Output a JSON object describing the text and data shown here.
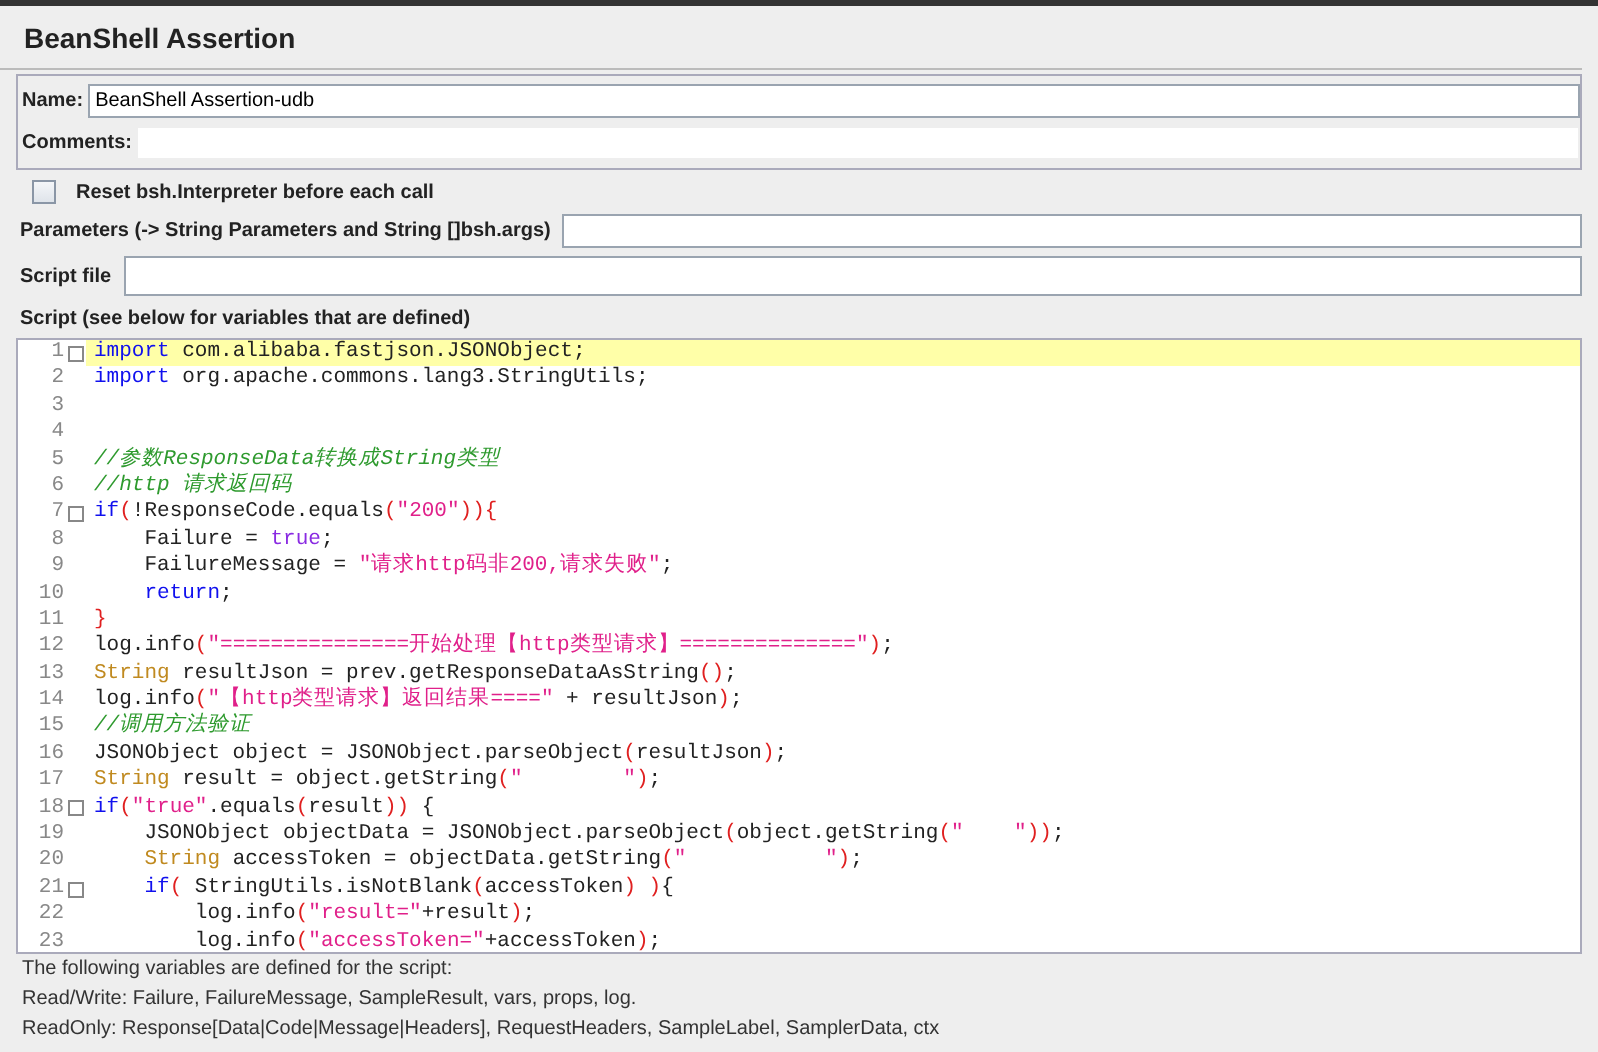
{
  "panel": {
    "title": "BeanShell Assertion"
  },
  "name_field": {
    "label": "Name:",
    "value": "BeanShell Assertion-udb"
  },
  "comments_field": {
    "label": "Comments:"
  },
  "reset_checkbox": {
    "label": "Reset bsh.Interpreter before each call",
    "checked": false
  },
  "parameters_field": {
    "label": "Parameters (-> String Parameters and String []bsh.args)"
  },
  "script_file_field": {
    "label": "Script file"
  },
  "script": {
    "label": "Script (see below for variables that are defined)",
    "lines": [
      {
        "number": "1",
        "fold": true,
        "current": true,
        "tokens": [
          {
            "kind": "keyword",
            "text": "import"
          },
          {
            "kind": "plain",
            "text": " com.alibaba.fastjson.JSONObject;"
          }
        ]
      },
      {
        "number": "2",
        "fold": false,
        "current": false,
        "tokens": [
          {
            "kind": "keyword",
            "text": "import"
          },
          {
            "kind": "plain",
            "text": " org.apache.commons.lang3.StringUtils;"
          }
        ]
      },
      {
        "number": "3",
        "fold": false,
        "current": false
      },
      {
        "number": "4",
        "fold": false,
        "current": false
      },
      {
        "number": "5",
        "fold": false,
        "current": false,
        "tokens": [
          {
            "kind": "comment",
            "text": "//参数ResponseData转换成String类型"
          }
        ]
      },
      {
        "number": "6",
        "fold": false,
        "current": false,
        "tokens": [
          {
            "kind": "comment",
            "text": "//http 请求返回码"
          }
        ]
      },
      {
        "number": "7",
        "fold": true,
        "current": false,
        "tokens": [
          {
            "kind": "keyword",
            "text": "if"
          },
          {
            "kind": "paren",
            "text": "("
          },
          {
            "kind": "plain",
            "text": "!ResponseCode.equals"
          },
          {
            "kind": "paren",
            "text": "("
          },
          {
            "kind": "string",
            "text": "\"200\""
          },
          {
            "kind": "paren",
            "text": ")){"
          }
        ]
      },
      {
        "number": "8",
        "fold": false,
        "current": false,
        "tokens": [
          {
            "kind": "plain",
            "text": "    Failure = "
          },
          {
            "kind": "literal",
            "text": "true"
          },
          {
            "kind": "plain",
            "text": ";"
          }
        ]
      },
      {
        "number": "9",
        "fold": false,
        "current": false,
        "tokens": [
          {
            "kind": "plain",
            "text": "    FailureMessage = "
          },
          {
            "kind": "string",
            "text": "\"请求http码非200,请求失败\""
          },
          {
            "kind": "plain",
            "text": ";"
          }
        ]
      },
      {
        "number": "10",
        "fold": false,
        "current": false,
        "tokens": [
          {
            "kind": "keyword",
            "text": "    return"
          },
          {
            "kind": "plain",
            "text": ";"
          }
        ]
      },
      {
        "number": "11",
        "fold": false,
        "current": false,
        "tokens": [
          {
            "kind": "paren",
            "text": "}"
          }
        ]
      },
      {
        "number": "12",
        "fold": false,
        "current": false,
        "tokens": [
          {
            "kind": "plain",
            "text": "log.info"
          },
          {
            "kind": "paren",
            "text": "("
          },
          {
            "kind": "string",
            "text": "\"===============开始处理【http类型请求】==============\""
          },
          {
            "kind": "paren",
            "text": ")"
          },
          {
            "kind": "plain",
            "text": ";"
          }
        ]
      },
      {
        "number": "13",
        "fold": false,
        "current": false,
        "tokens": [
          {
            "kind": "type",
            "text": "String"
          },
          {
            "kind": "plain",
            "text": " resultJson = prev.getResponseDataAsString"
          },
          {
            "kind": "paren",
            "text": "()"
          },
          {
            "kind": "plain",
            "text": ";"
          }
        ]
      },
      {
        "number": "14",
        "fold": false,
        "current": false,
        "tokens": [
          {
            "kind": "plain",
            "text": "log.info"
          },
          {
            "kind": "paren",
            "text": "("
          },
          {
            "kind": "string",
            "text": "\"【http类型请求】返回结果====\""
          },
          {
            "kind": "plain",
            "text": " + resultJson"
          },
          {
            "kind": "paren",
            "text": ")"
          },
          {
            "kind": "plain",
            "text": ";"
          }
        ]
      },
      {
        "number": "15",
        "fold": false,
        "current": false,
        "tokens": [
          {
            "kind": "comment",
            "text": "//调用方法验证"
          }
        ]
      },
      {
        "number": "16",
        "fold": false,
        "current": false,
        "tokens": [
          {
            "kind": "plain",
            "text": "JSONObject object = JSONObject.parseObject"
          },
          {
            "kind": "paren",
            "text": "("
          },
          {
            "kind": "plain",
            "text": "resultJson"
          },
          {
            "kind": "paren",
            "text": ")"
          },
          {
            "kind": "plain",
            "text": ";"
          }
        ]
      },
      {
        "number": "17",
        "fold": false,
        "current": false,
        "tokens": [
          {
            "kind": "type",
            "text": "String"
          },
          {
            "kind": "plain",
            "text": " result = object.getString"
          },
          {
            "kind": "paren",
            "text": "("
          },
          {
            "kind": "string",
            "text": "\"        \""
          },
          {
            "kind": "paren",
            "text": ")"
          },
          {
            "kind": "plain",
            "text": ";"
          }
        ]
      },
      {
        "number": "18",
        "fold": true,
        "current": false,
        "tokens": [
          {
            "kind": "keyword",
            "text": "if"
          },
          {
            "kind": "paren",
            "text": "("
          },
          {
            "kind": "string",
            "text": "\"true\""
          },
          {
            "kind": "plain",
            "text": ".equals"
          },
          {
            "kind": "paren",
            "text": "("
          },
          {
            "kind": "plain",
            "text": "result"
          },
          {
            "kind": "paren",
            "text": "))"
          },
          {
            "kind": "plain",
            "text": " {"
          }
        ]
      },
      {
        "number": "19",
        "fold": false,
        "current": false,
        "tokens": [
          {
            "kind": "plain",
            "text": "    JSONObject objectData = JSONObject.parseObject"
          },
          {
            "kind": "paren",
            "text": "("
          },
          {
            "kind": "plain",
            "text": "object.getString"
          },
          {
            "kind": "paren",
            "text": "("
          },
          {
            "kind": "string",
            "text": "\"    \""
          },
          {
            "kind": "paren",
            "text": "))"
          },
          {
            "kind": "plain",
            "text": ";"
          }
        ]
      },
      {
        "number": "20",
        "fold": false,
        "current": false,
        "tokens": [
          {
            "kind": "type",
            "text": "    String"
          },
          {
            "kind": "plain",
            "text": " accessToken = objectData.getString"
          },
          {
            "kind": "paren",
            "text": "("
          },
          {
            "kind": "string",
            "text": "\"           \""
          },
          {
            "kind": "paren",
            "text": ")"
          },
          {
            "kind": "plain",
            "text": ";"
          }
        ]
      },
      {
        "number": "21",
        "fold": true,
        "current": false,
        "tokens": [
          {
            "kind": "keyword",
            "text": "    if"
          },
          {
            "kind": "paren",
            "text": "("
          },
          {
            "kind": "plain",
            "text": " StringUtils.isNotBlank"
          },
          {
            "kind": "paren",
            "text": "("
          },
          {
            "kind": "plain",
            "text": "accessToken"
          },
          {
            "kind": "paren",
            "text": ") )"
          },
          {
            "kind": "plain",
            "text": "{"
          }
        ]
      },
      {
        "number": "22",
        "fold": false,
        "current": false,
        "tokens": [
          {
            "kind": "plain",
            "text": "        log.info"
          },
          {
            "kind": "paren",
            "text": "("
          },
          {
            "kind": "string",
            "text": "\"result=\""
          },
          {
            "kind": "plain",
            "text": "+result"
          },
          {
            "kind": "paren",
            "text": ")"
          },
          {
            "kind": "plain",
            "text": ";"
          }
        ]
      },
      {
        "number": "23",
        "fold": false,
        "current": false,
        "tokens": [
          {
            "kind": "plain",
            "text": "        log.info"
          },
          {
            "kind": "paren",
            "text": "("
          },
          {
            "kind": "string",
            "text": "\"accessToken=\""
          },
          {
            "kind": "plain",
            "text": "+accessToken"
          },
          {
            "kind": "paren",
            "text": ")"
          },
          {
            "kind": "plain",
            "text": ";"
          }
        ]
      }
    ]
  },
  "variables_help": [
    "The following variables are defined for the script:",
    "Read/Write: Failure, FailureMessage, SampleResult, vars, props, log.",
    "ReadOnly: Response[Data|Code|Message|Headers], RequestHeaders, SampleLabel, SamplerData, ctx"
  ]
}
